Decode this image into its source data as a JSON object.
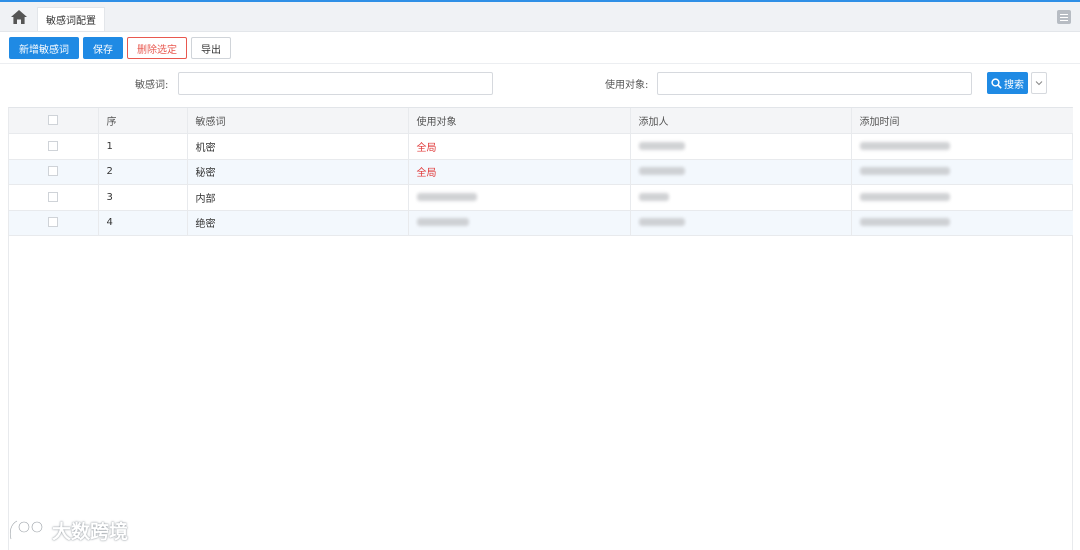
{
  "tabbar": {
    "home_icon": "home-icon",
    "active_tab": "敏感词配置",
    "menu_icon": "list-menu-icon"
  },
  "toolbar": {
    "add_label": "新增敏感词",
    "save_label": "保存",
    "delete_selected_label": "删除选定",
    "export_label": "导出"
  },
  "search": {
    "keyword_label": "敏感词:",
    "keyword_value": "",
    "target_label": "使用对象:",
    "target_value": "",
    "search_label": "搜索",
    "search_icon": "search-icon",
    "expand_icon": "chevron-down-icon"
  },
  "table": {
    "columns": [
      "序",
      "敏感词",
      "使用对象",
      "添加人",
      "添加时间"
    ],
    "rows": [
      {
        "index": "1",
        "word": "机密",
        "target": "全局"
      },
      {
        "index": "2",
        "word": "秘密",
        "target": "全局"
      },
      {
        "index": "3",
        "word": "内部",
        "target": ""
      },
      {
        "index": "4",
        "word": "绝密",
        "target": ""
      }
    ]
  },
  "watermark": {
    "text": "大数跨境"
  },
  "colors": {
    "primary": "#1f8ae4",
    "danger": "#e8584f",
    "global_scope": "#e03a3a",
    "accent_bar": "#2f8fe6"
  }
}
